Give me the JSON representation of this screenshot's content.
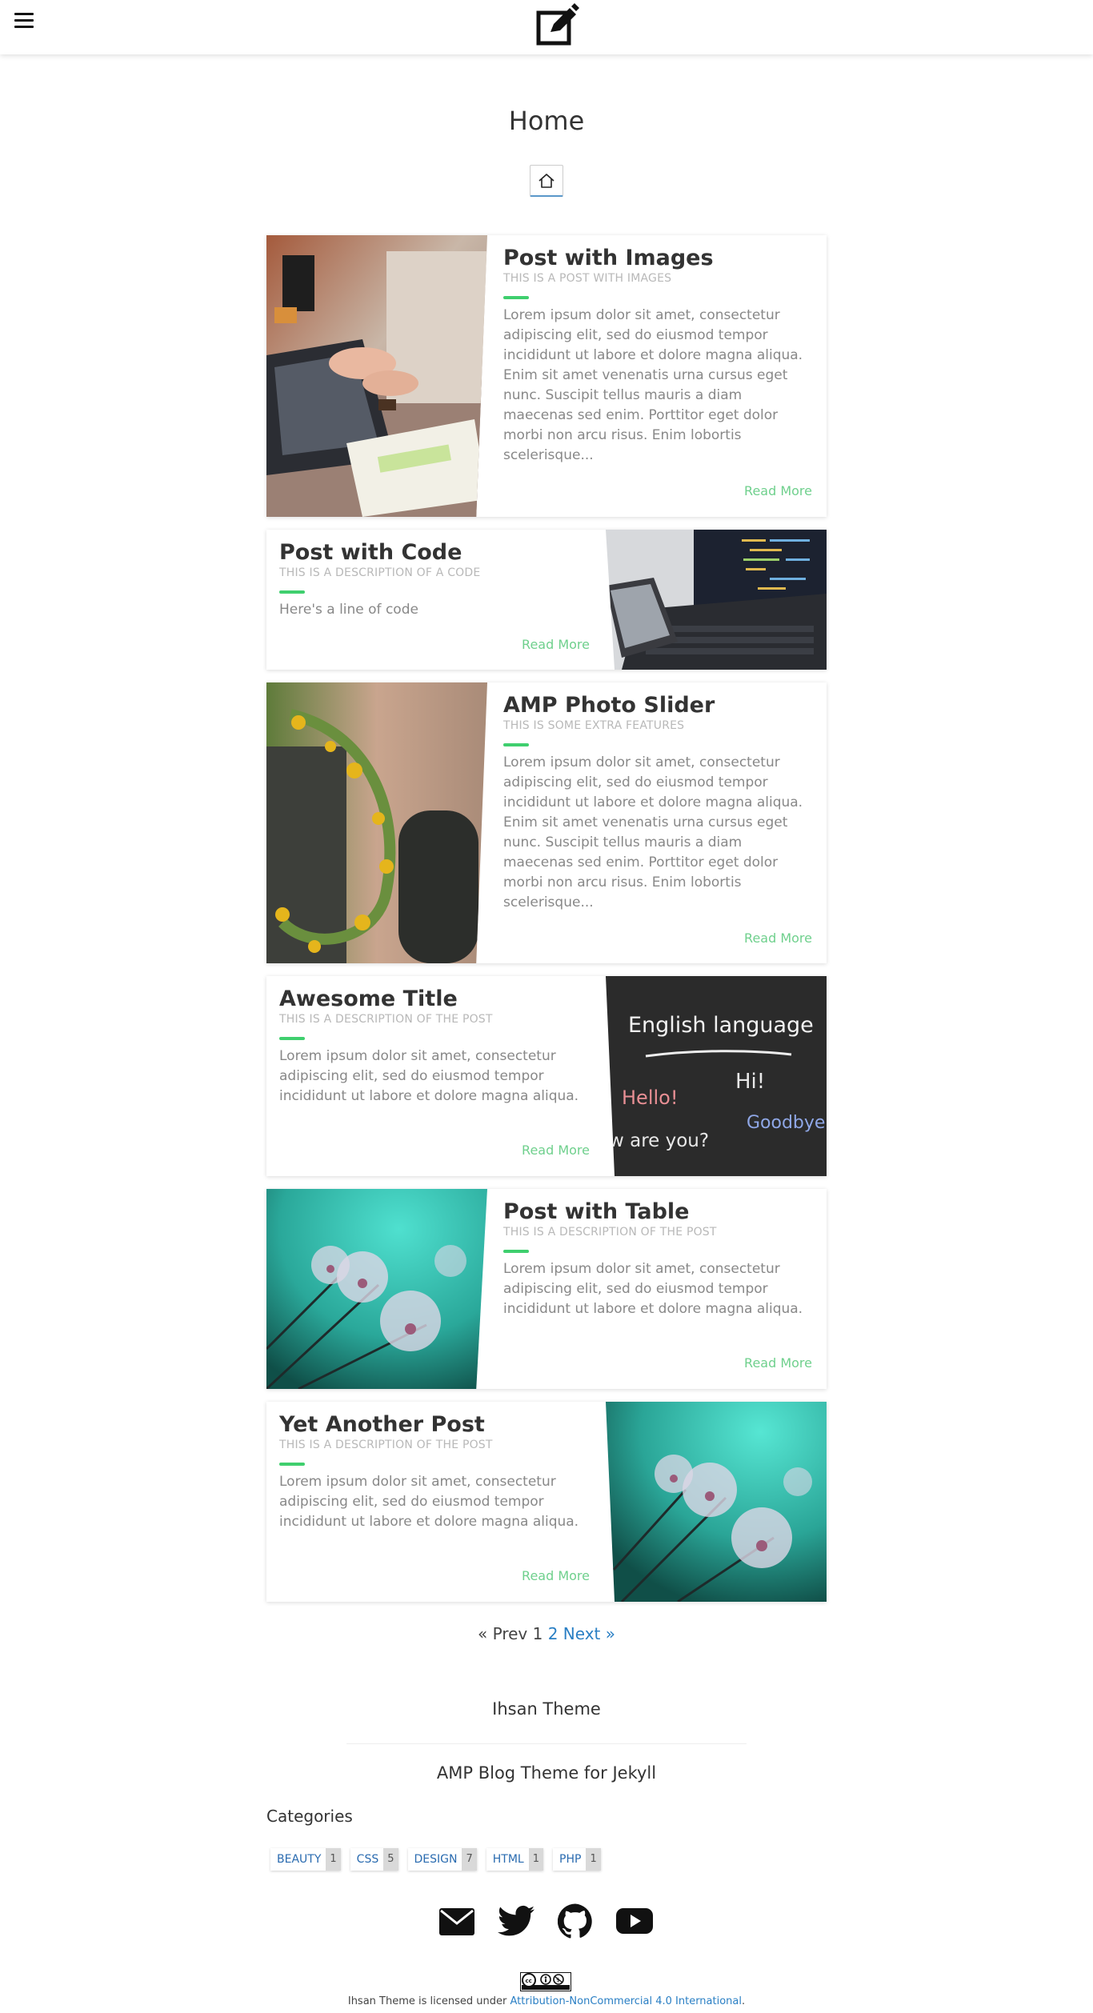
{
  "header": {
    "menu_icon": "hamburger-icon",
    "logo_icon": "edit-icon"
  },
  "page": {
    "title": "Home",
    "home_icon": "home-icon"
  },
  "posts": [
    {
      "title": "Post with Images",
      "subtitle": "THIS IS A POST WITH IMAGES",
      "excerpt": "Lorem ipsum dolor sit amet, consectetur adipiscing elit, sed do eiusmod tempor incididunt ut labore et dolore magna aliqua. Enim sit amet venenatis urna cursus eget nunc. Suscipit tellus mauris a diam maecenas sed enim. Porttitor eget dolor morbi non arcu risus. Enim lobortis scelerisque...",
      "read_more": "Read More"
    },
    {
      "title": "Post with Code",
      "subtitle": "THIS IS A DESCRIPTION OF A CODE",
      "excerpt": "Here's a line of code",
      "read_more": "Read More"
    },
    {
      "title": "AMP Photo Slider",
      "subtitle": "THIS IS SOME EXTRA FEATURES",
      "excerpt": "Lorem ipsum dolor sit amet, consectetur adipiscing elit, sed do eiusmod tempor incididunt ut labore et dolore magna aliqua. Enim sit amet venenatis urna cursus eget nunc. Suscipit tellus mauris a diam maecenas sed enim. Porttitor eget dolor morbi non arcu risus. Enim lobortis scelerisque...",
      "read_more": "Read More"
    },
    {
      "title": "Awesome Title",
      "subtitle": "THIS IS A DESCRIPTION OF THE POST",
      "excerpt": "Lorem ipsum dolor sit amet, consectetur adipiscing elit, sed do eiusmod tempor incididunt ut labore et dolore magna aliqua.",
      "read_more": "Read More",
      "image_text": {
        "heading": "English language",
        "hi": "Hi!",
        "hello": "Hello!",
        "how": "w are you?",
        "goodbye": "Goodbye"
      }
    },
    {
      "title": "Post with Table",
      "subtitle": "THIS IS A DESCRIPTION OF THE POST",
      "excerpt": "Lorem ipsum dolor sit amet, consectetur adipiscing elit, sed do eiusmod tempor incididunt ut labore et dolore magna aliqua.",
      "read_more": "Read More"
    },
    {
      "title": "Yet Another Post",
      "subtitle": "THIS IS A DESCRIPTION OF THE POST",
      "excerpt": "Lorem ipsum dolor sit amet, consectetur adipiscing elit, sed do eiusmod tempor incididunt ut labore et dolore magna aliqua.",
      "read_more": "Read More"
    }
  ],
  "pagination": {
    "prev": "« Prev",
    "current": "1",
    "page2": "2",
    "next": "Next »"
  },
  "footer": {
    "title": "Ihsan Theme",
    "subtitle": "AMP Blog Theme for Jekyll",
    "categories_title": "Categories",
    "categories": [
      {
        "name": "BEAUTY",
        "count": "1"
      },
      {
        "name": "CSS",
        "count": "5"
      },
      {
        "name": "DESIGN",
        "count": "7"
      },
      {
        "name": "HTML",
        "count": "1"
      },
      {
        "name": "PHP",
        "count": "1"
      }
    ],
    "social_icons": [
      "email-icon",
      "twitter-icon",
      "github-icon",
      "youtube-icon"
    ],
    "license_prefix": "Ihsan Theme is licensed under ",
    "license_link": "Attribution-NonCommercial 4.0 International",
    "license_suffix": "."
  },
  "colors": {
    "accent_green": "#3fcf6e",
    "read_more": "#6fd08d",
    "link_blue": "#2a7fc4"
  }
}
